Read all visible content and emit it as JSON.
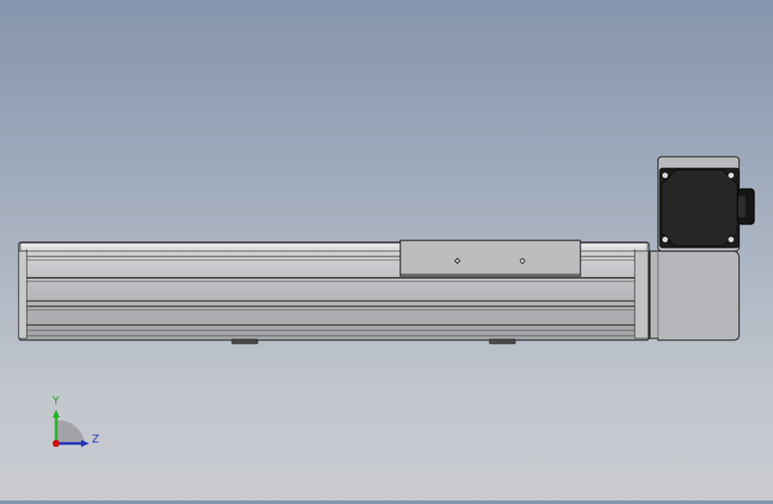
{
  "view": {
    "background_top": "#8595ad",
    "background_bottom": "#c9cbd0",
    "model": "linear-actuator-with-stepper-motor"
  },
  "triad": {
    "y_label": "Y",
    "z_label": "Z",
    "y_color": "#22b422",
    "z_color": "#2233bb",
    "x_color": "#cc1111"
  }
}
